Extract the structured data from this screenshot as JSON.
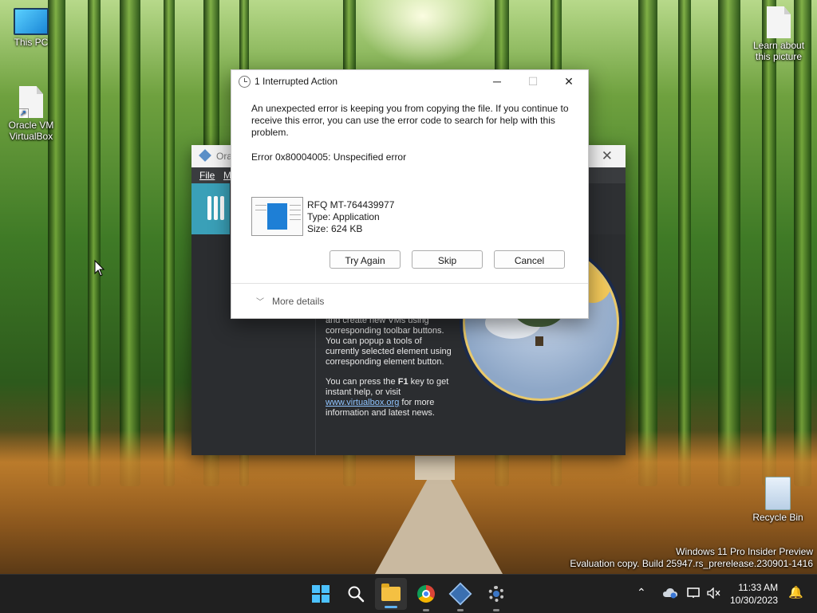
{
  "desktop": {
    "icons_left": [
      {
        "label": "This PC"
      },
      {
        "label": "Oracle VM VirtualBox"
      }
    ],
    "learn_label": "Learn about this picture",
    "recycle_label": "Recycle Bin",
    "watermark_line1": "Windows 11 Pro Insider Preview",
    "watermark_line2": "Evaluation copy. Build 25947.rs_prerelease.230901-1416"
  },
  "vbox": {
    "title": "Ora",
    "menu_file": "File",
    "menu_m": "M",
    "welcome_p1": "and create new VMs using corresponding toolbar buttons. You can popup a tools of currently selected element using corresponding element button.",
    "welcome_p2_pre": "You can press the ",
    "welcome_p2_key": "F1",
    "welcome_p2_post": " key to get instant help, or visit",
    "welcome_link": "www.virtualbox.org",
    "welcome_p2_tail": " for more information and latest news."
  },
  "dialog": {
    "title": "1 Interrupted Action",
    "message": "An unexpected error is keeping you from copying the file. If you continue to receive this error, you can use the error code to search for help with this problem.",
    "error": "Error 0x80004005: Unspecified error",
    "file_name": "RFQ MT-764439977",
    "file_type": "Type: Application",
    "file_size": "Size: 624 KB",
    "btn_try": "Try Again",
    "btn_skip": "Skip",
    "btn_cancel": "Cancel",
    "more_details": "More details",
    "minimize_glyph": "─",
    "maximize_glyph": "☐",
    "close_glyph": "✕"
  },
  "taskbar": {
    "time": "11:33 AM",
    "date": "10/30/2023",
    "chevron_glyph": "⌃",
    "bell_glyph": "🔔"
  },
  "colors": {
    "accent": "#4cc2ff",
    "taskbar_bg": "#202020",
    "dialog_bg": "#ffffff",
    "link": "#8fc4ff"
  }
}
